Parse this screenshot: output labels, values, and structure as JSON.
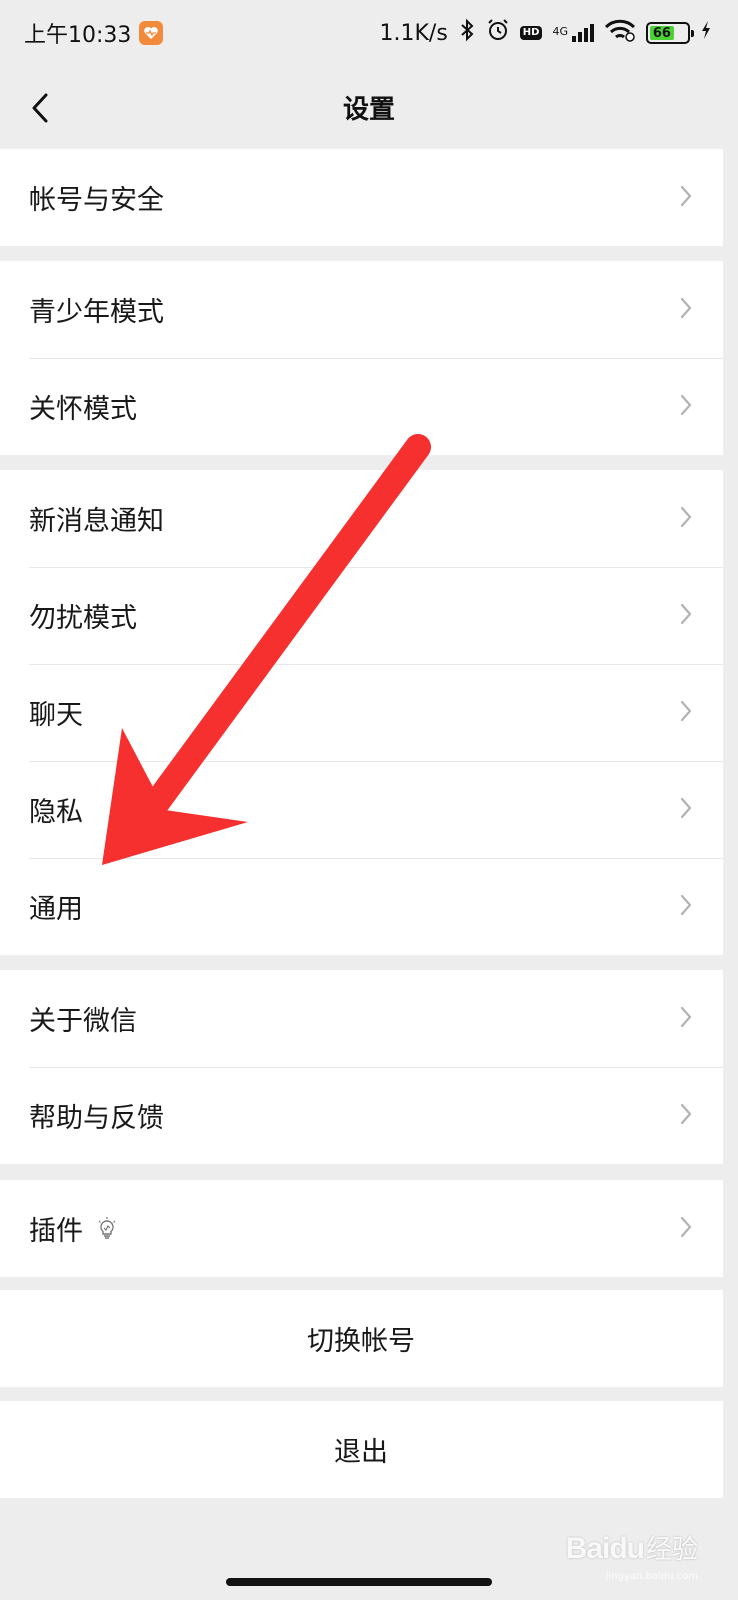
{
  "status_bar": {
    "time": "上午10:33",
    "net_speed": "1.1K/s",
    "hd_label": "HD",
    "net_type": "4G",
    "battery": "66",
    "battery_level": 0.66,
    "icons": [
      "health-app-icon",
      "bluetooth-icon",
      "alarm-icon",
      "signal-icon",
      "wifi-icon",
      "battery-icon",
      "charging-icon"
    ]
  },
  "nav": {
    "title": "设置",
    "back_icon": "chevron-left-icon"
  },
  "groups": [
    {
      "items": [
        "帐号与安全"
      ]
    },
    {
      "items": [
        "青少年模式",
        "关怀模式"
      ]
    },
    {
      "items": [
        "新消息通知",
        "勿扰模式",
        "聊天",
        "隐私",
        "通用"
      ]
    },
    {
      "items": [
        "关于微信",
        "帮助与反馈"
      ]
    },
    {
      "items": [
        "插件"
      ]
    }
  ],
  "actions": {
    "switch_account": "切换帐号",
    "logout": "退出"
  },
  "annotation": {
    "arrow_color": "#f5302e",
    "points_to": "通用"
  },
  "watermark": {
    "brand": "Bai",
    "brand_rest": "du",
    "suffix": "经验",
    "url": "jingyan.baidu.com"
  },
  "colors": {
    "background": "#ededed",
    "row": "#ffffff",
    "text": "#191919",
    "chevron": "#b2b2b2",
    "battery": "#4cd137"
  }
}
